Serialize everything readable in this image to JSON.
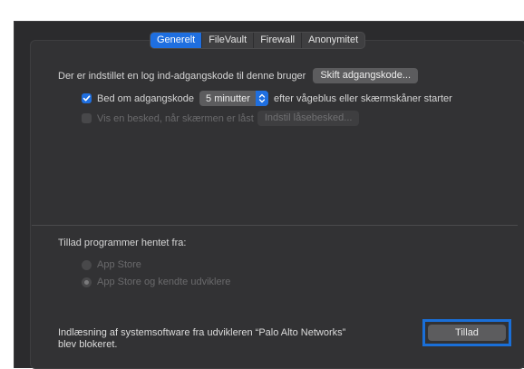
{
  "tabs": [
    {
      "label": "Generelt",
      "active": true
    },
    {
      "label": "FileVault",
      "active": false
    },
    {
      "label": "Firewall",
      "active": false
    },
    {
      "label": "Anonymitet",
      "active": false
    }
  ],
  "login": {
    "text": "Der er indstillet en log ind-adgangskode til denne bruger",
    "change_button": "Skift adgangskode..."
  },
  "require_password": {
    "checked": true,
    "label": "Bed om adgangskode",
    "delay_value": "5 minutter",
    "suffix": "efter vågeblus eller skærmskåner starter"
  },
  "lock_message": {
    "checked": false,
    "label": "Vis en besked, når skærmen er låst",
    "button": "Indstil låsebesked..."
  },
  "allow_apps": {
    "heading": "Tillad programmer hentet fra:",
    "options": [
      {
        "label": "App Store",
        "selected": false
      },
      {
        "label": "App Store og kendte udviklere",
        "selected": true
      }
    ]
  },
  "blocked": {
    "line1": "Indlæsning af systemsoftware fra udvikleren “Palo Alto Networks”",
    "line2": "blev blokeret.",
    "allow_button": "Tillad"
  },
  "colors": {
    "accent": "#1f6fe0",
    "highlight_border": "#1a6fd8",
    "pane_bg": "#2b2b2d"
  }
}
